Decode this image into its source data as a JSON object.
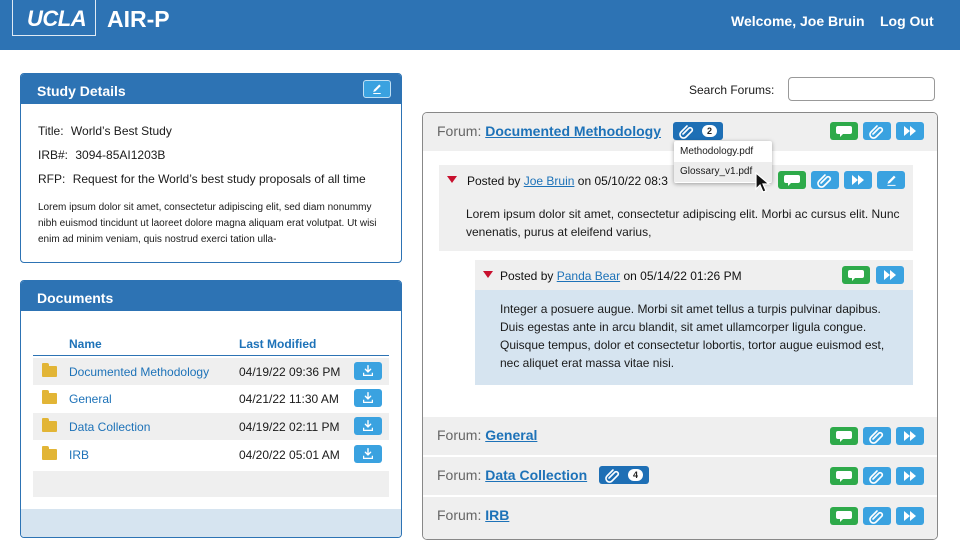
{
  "header": {
    "logo": "UCLA",
    "app_title": "AIR-P",
    "welcome": "Welcome, Joe Bruin",
    "logout": "Log Out",
    "background": "#2d73b4"
  },
  "study_details": {
    "title": "Study Details",
    "fields": [
      {
        "label": "Title:",
        "value": "World’s Best Study"
      },
      {
        "label": "IRB#:",
        "value": "3094-85AI1203B"
      },
      {
        "label": "RFP:",
        "value": "Request for the World’s best study proposals of all time"
      }
    ],
    "description": "Lorem ipsum dolor sit amet, consectetur adipiscing elit, sed diam nonummy nibh euismod tincidunt ut laoreet dolore magna aliquam erat volutpat. Ut wisi enim ad minim veniam, quis nostrud exerci tation ulla-"
  },
  "documents": {
    "title": "Documents",
    "columns": [
      "Name",
      "Last Modified"
    ],
    "rows": [
      {
        "name": "Documented Methodology",
        "modified": "04/19/22 09:36 PM"
      },
      {
        "name": "General",
        "modified": "04/21/22 11:30 AM"
      },
      {
        "name": "Data Collection",
        "modified": "04/19/22 02:11 PM"
      },
      {
        "name": "IRB",
        "modified": "04/20/22 05:01 AM"
      }
    ]
  },
  "search": {
    "label": "Search Forums:",
    "value": "",
    "placeholder": ""
  },
  "forums": [
    {
      "prefix": "Forum:",
      "name": "Documented Methodology",
      "attachments": "2"
    },
    {
      "prefix": "Forum:",
      "name": "General"
    },
    {
      "prefix": "Forum:",
      "name": "Data Collection",
      "attachments": "4"
    },
    {
      "prefix": "Forum:",
      "name": "IRB"
    }
  ],
  "attachment_dropdown": {
    "items": [
      "Methodology.pdf",
      "Glossary_v1.pdf"
    ],
    "highlighted": "Glossary_v1.pdf"
  },
  "posts": [
    {
      "posted_prefix": "Posted by",
      "author": "Joe Bruin",
      "date_prefix": "on",
      "date": "05/10/22 08:3",
      "body": "Lorem ipsum dolor sit amet, consectetur adipiscing elit. Morbi ac cursus elit. Nunc venenatis, purus at eleifend varius,"
    },
    {
      "posted_prefix": "Posted by",
      "author": "Panda Bear",
      "date_prefix": "on",
      "date": "05/14/22 01:26 PM",
      "body": "Integer a posuere augue. Morbi sit amet tellus a turpis pulvinar dapibus. Duis egestas ante in arcu blandit, sit amet ullamcorper ligula congue. Quisque tempus, dolor et consectetur lobortis, tortor augue euismod est, nec aliquet erat massa vitae nisi."
    }
  ],
  "colors": {
    "accent": "#2d73b4",
    "reply": "#2eaa4a",
    "action": "#3aa2e0",
    "badge": "#1e6fb5",
    "link": "#1d72b8",
    "expand_arrow": "#c8102e"
  },
  "icons": [
    "chat-bubble-icon",
    "paperclip-icon",
    "fast-forward-icon",
    "pencil-icon",
    "download-icon",
    "folder-icon",
    "caret-down-icon",
    "mouse-cursor-icon"
  ]
}
